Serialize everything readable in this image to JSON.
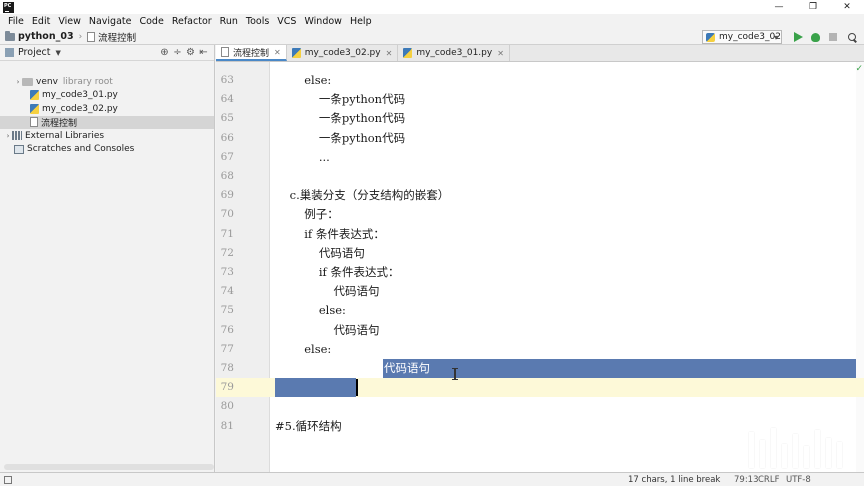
{
  "window": {
    "min": "—",
    "restore": "❐",
    "close": "✕"
  },
  "menu": [
    "File",
    "Edit",
    "View",
    "Navigate",
    "Code",
    "Refactor",
    "Run",
    "Tools",
    "VCS",
    "Window",
    "Help"
  ],
  "breadcrumb": {
    "project": "python_03",
    "file": "流程控制"
  },
  "run_config": {
    "label": "my_code3_02"
  },
  "project_panel": {
    "title": "Project",
    "tree": [
      {
        "label": "venv",
        "note": "library root",
        "icon": "venv-folder-icon",
        "arrow": "›",
        "indent": 14,
        "kind": "venv"
      },
      {
        "label": "my_code3_01.py",
        "icon": "python-file-icon",
        "arrow": "",
        "indent": 30,
        "kind": "py"
      },
      {
        "label": "my_code3_02.py",
        "icon": "python-file-icon",
        "arrow": "",
        "indent": 30,
        "kind": "py"
      },
      {
        "label": "流程控制",
        "icon": "text-file-icon",
        "arrow": "",
        "indent": 30,
        "kind": "txt",
        "selected": true
      },
      {
        "label": "External Libraries",
        "icon": "library-icon",
        "arrow": "›",
        "indent": 4,
        "kind": "lib"
      },
      {
        "label": "Scratches and Consoles",
        "icon": "scratch-icon",
        "arrow": "",
        "indent": 14,
        "kind": "scratch"
      }
    ]
  },
  "tabs": [
    {
      "label": "流程控制",
      "active": true,
      "kind": "txt"
    },
    {
      "label": "my_code3_02.py",
      "active": false,
      "kind": "py"
    },
    {
      "label": "my_code3_01.py",
      "active": false,
      "kind": "py"
    }
  ],
  "editor": {
    "lines": [
      {
        "no": "63",
        "text": "        else:"
      },
      {
        "no": "64",
        "text": "            一条python代码"
      },
      {
        "no": "65",
        "text": "            一条python代码"
      },
      {
        "no": "66",
        "text": "            一条python代码"
      },
      {
        "no": "67",
        "text": "            ..."
      },
      {
        "no": "68",
        "text": ""
      },
      {
        "no": "69",
        "text": "    c.巢装分支（分支结构的嵌套）"
      },
      {
        "no": "70",
        "text": "        例子："
      },
      {
        "no": "71",
        "text": "        if 条件表达式："
      },
      {
        "no": "72",
        "text": "            代码语句"
      },
      {
        "no": "73",
        "text": "            if 条件表达式："
      },
      {
        "no": "74",
        "text": "                代码语句"
      },
      {
        "no": "75",
        "text": "            else:"
      },
      {
        "no": "76",
        "text": "                代码语句"
      },
      {
        "no": "77",
        "text": "        else:"
      },
      {
        "no": "78",
        "text": ""
      },
      {
        "no": "79",
        "text": ""
      },
      {
        "no": "80",
        "text": ""
      },
      {
        "no": "81",
        "text": "#5.循环结构"
      }
    ],
    "selected_text": "代码语句"
  },
  "status": {
    "selection": "17 chars, 1 line break",
    "position": "79:13",
    "line_sep": "CRLF",
    "encoding": "UTF-8"
  }
}
